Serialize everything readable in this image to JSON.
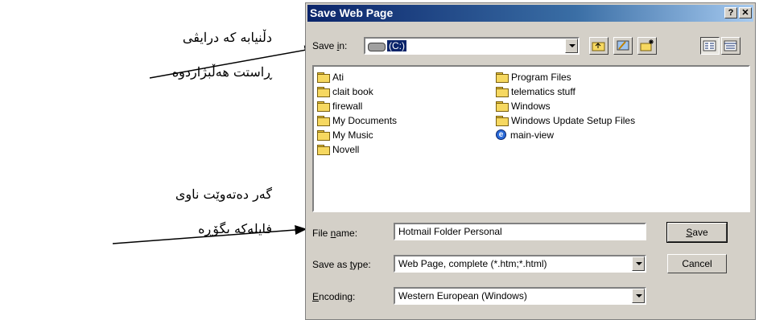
{
  "annotations": {
    "note1_line1": "دڵنیابە کە درایڤی",
    "note1_line2": "ڕاستت هەڵبژاردوە",
    "note2_line1": "گەر دەتەوێت ناوی",
    "note2_line2": "فایلەکە بگۆڕە"
  },
  "dialog": {
    "title": "Save Web Page",
    "help_label": "?",
    "close_label": "✕",
    "save_in": {
      "label_pre": "Save ",
      "label_u": "i",
      "label_post": "n:",
      "value": "(C:)"
    },
    "toolbar_icons": [
      "up-folder-icon",
      "desktop-icon",
      "new-folder-icon",
      "list-view-icon",
      "details-view-icon"
    ],
    "files_left": [
      {
        "name": "Ati",
        "icon": "folder-icon"
      },
      {
        "name": "clait book",
        "icon": "folder-icon"
      },
      {
        "name": "firewall",
        "icon": "folder-icon"
      },
      {
        "name": "My Documents",
        "icon": "my-documents-icon"
      },
      {
        "name": "My Music",
        "icon": "folder-icon"
      },
      {
        "name": "Novell",
        "icon": "folder-icon"
      }
    ],
    "files_right": [
      {
        "name": "Program Files",
        "icon": "folder-icon"
      },
      {
        "name": "telematics stuff",
        "icon": "folder-icon"
      },
      {
        "name": "Windows",
        "icon": "folder-icon"
      },
      {
        "name": "Windows Update Setup Files",
        "icon": "folder-icon"
      },
      {
        "name": "main-view",
        "icon": "ie-page-icon"
      }
    ],
    "file_name": {
      "label_pre": "File ",
      "label_u": "n",
      "label_post": "ame:",
      "value": "Hotmail Folder Personal"
    },
    "save_as_type": {
      "label_pre": "Save as ",
      "label_u": "t",
      "label_post": "ype:",
      "value": "Web Page, complete (*.htm;*.html)"
    },
    "encoding": {
      "label_pre": "",
      "label_u": "E",
      "label_post": "ncoding:",
      "value": "Western European (Windows)"
    },
    "save_button": {
      "u": "S",
      "rest": "ave"
    },
    "cancel_button": "Cancel"
  }
}
